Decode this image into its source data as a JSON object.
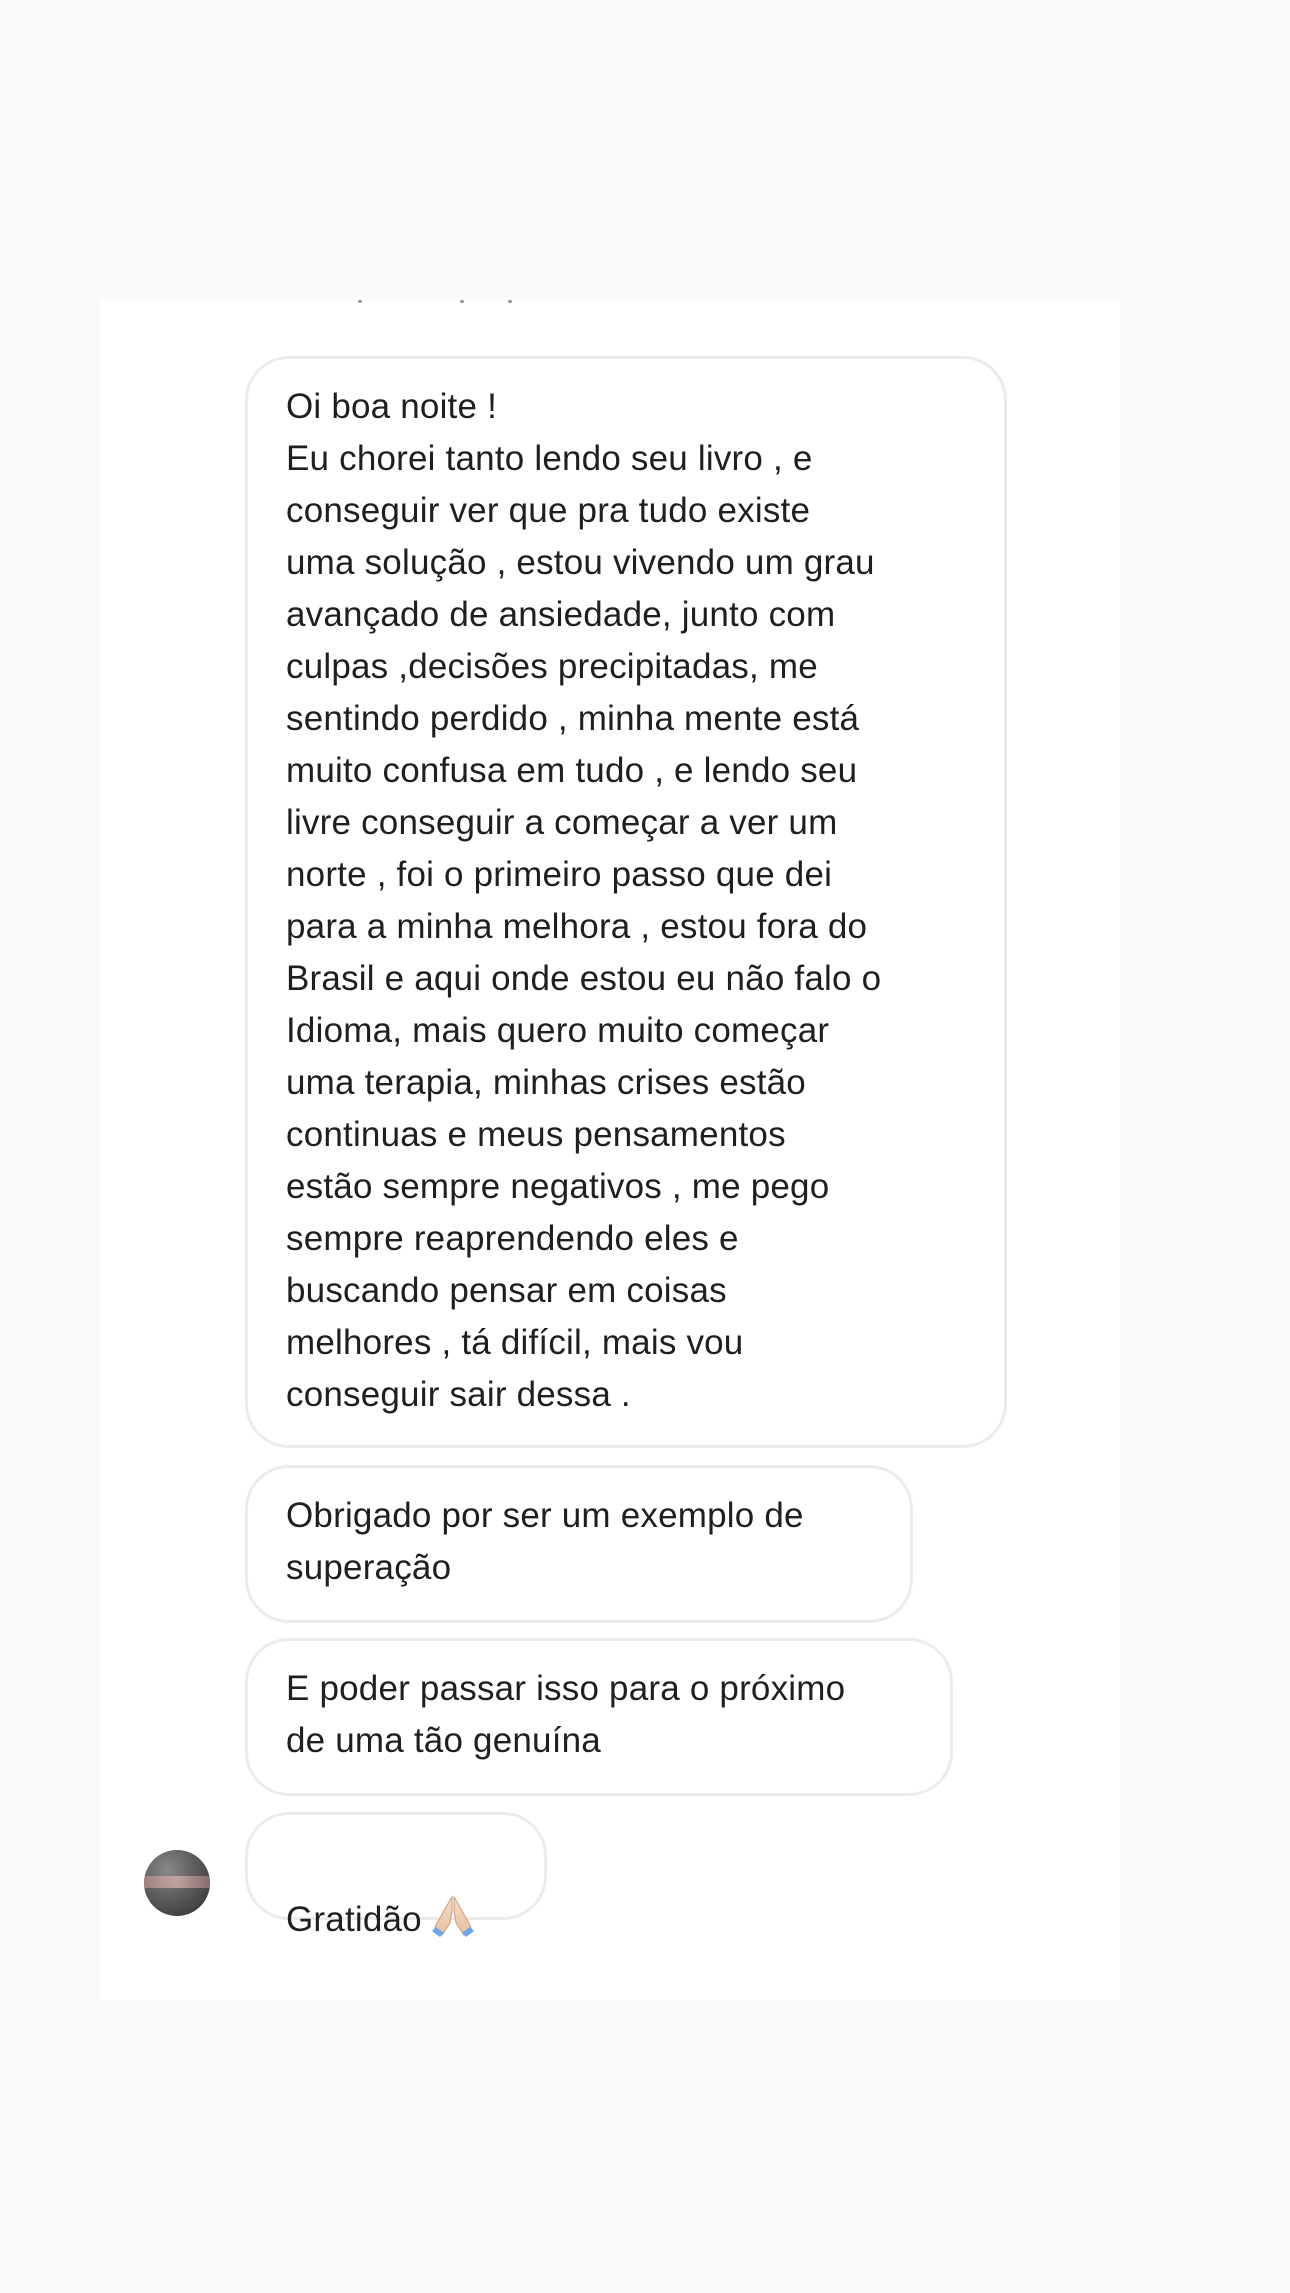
{
  "conversation": {
    "messages": [
      {
        "text": "Oi boa noite !\nEu chorei tanto lendo seu livro , e\nconseguir ver que pra tudo existe\numa solução , estou vivendo um grau\navançado de ansiedade, junto com\nculpas ,decisões precipitadas, me\nsentindo perdido , minha mente está\nmuito confusa em tudo , e lendo seu\nlivre conseguir a começar a ver um\nnorte , foi o primeiro passo que dei\npara a minha melhora , estou fora do\nBrasil e aqui onde estou eu não falo o\nIdioma, mais quero muito começar\numa terapia, minhas crises estão\ncontinuas e meus pensamentos\nestão sempre negativos , me pego\nsempre reaprendendo eles e\nbuscando pensar em coisas\nmelhores , tá difícil, mais vou\nconseguir sair dessa ."
      },
      {
        "text": "Obrigado por ser um exemplo de\nsuperação"
      },
      {
        "text": "E poder passar isso para o próximo\nde uma tão genuína"
      },
      {
        "text": "Gratidão",
        "emoji": "folded-hands-emoji"
      }
    ],
    "sender_avatar": "avatar-icon"
  }
}
